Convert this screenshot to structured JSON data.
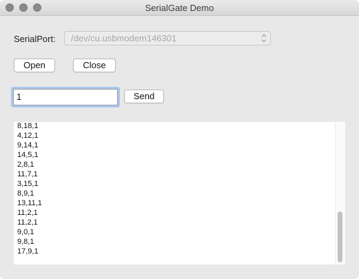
{
  "window": {
    "title": "SerialGate Demo"
  },
  "serial_port": {
    "label": "SerialPort:",
    "selected_value": "/dev/cu.usbmodem146301",
    "icon": "updown-chevron-icon"
  },
  "buttons": {
    "open_label": "Open",
    "close_label": "Close",
    "send_label": "Send"
  },
  "send_input": {
    "value": "1"
  },
  "log": {
    "lines": [
      "8,18,1",
      "4,12,1",
      "9,14,1",
      "14,5,1",
      "2,8,1",
      "11,7,1",
      "3,15,1",
      "8,9,1",
      "13,11,1",
      "11,2,1",
      "11,2,1",
      "9,0,1",
      "9,8,1",
      "17,9,1"
    ]
  },
  "colors": {
    "window_bg": "#e8e8e8",
    "focus_ring": "#a9c7ee",
    "disabled_text": "#a8a8a8"
  }
}
